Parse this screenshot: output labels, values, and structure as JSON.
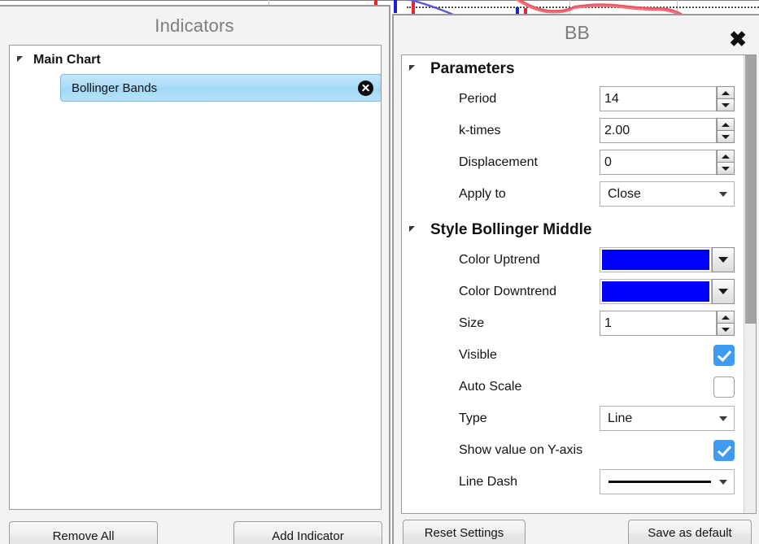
{
  "indicators_panel": {
    "title": "Indicators",
    "tree": {
      "group_label": "Main Chart",
      "expander_icon": "triangle-collapse-icon",
      "items": [
        {
          "label": "Bollinger Bands",
          "remove_icon": "remove-circle-x-icon",
          "selected": true
        }
      ]
    },
    "buttons": {
      "remove_all": "Remove All",
      "add_indicator": "Add Indicator"
    }
  },
  "bb_dialog": {
    "title": "BB",
    "close_icon": "close-x-icon",
    "sections": [
      {
        "expander_icon": "triangle-collapse-icon",
        "title": "Parameters",
        "rows": [
          {
            "label": "Period",
            "type": "spinner",
            "value": "14"
          },
          {
            "label": "k-times",
            "type": "spinner",
            "value": "2.00"
          },
          {
            "label": "Displacement",
            "type": "spinner",
            "value": "0"
          },
          {
            "label": "Apply to",
            "type": "combo",
            "value": "Close"
          }
        ]
      },
      {
        "expander_icon": "triangle-collapse-icon",
        "title": "Style Bollinger Middle",
        "rows": [
          {
            "label": "Color Uptrend",
            "type": "color",
            "value": "#0000FF"
          },
          {
            "label": "Color Downtrend",
            "type": "color",
            "value": "#0000FF"
          },
          {
            "label": "Size",
            "type": "spinner",
            "value": "1"
          },
          {
            "label": "Visible",
            "type": "checkbox",
            "checked": true
          },
          {
            "label": "Auto Scale",
            "type": "checkbox",
            "checked": false
          },
          {
            "label": "Type",
            "type": "combo",
            "value": "Line"
          },
          {
            "label": "Show value on Y-axis",
            "type": "checkbox",
            "checked": true
          },
          {
            "label": "Line Dash",
            "type": "dash",
            "value": "solid"
          }
        ]
      }
    ],
    "buttons": {
      "reset_settings": "Reset Settings",
      "save_as_default": "Save as default"
    },
    "scrollbar": {
      "orientation": "vertical",
      "thumb_at_top": true
    }
  },
  "colors": {
    "accent_checkbox": "#3E9BF0",
    "selection_blue": "#A9DCF7",
    "series_blue": "#0000FF",
    "chart_red": "#E8262B",
    "chart_blue": "#1A23C8"
  }
}
